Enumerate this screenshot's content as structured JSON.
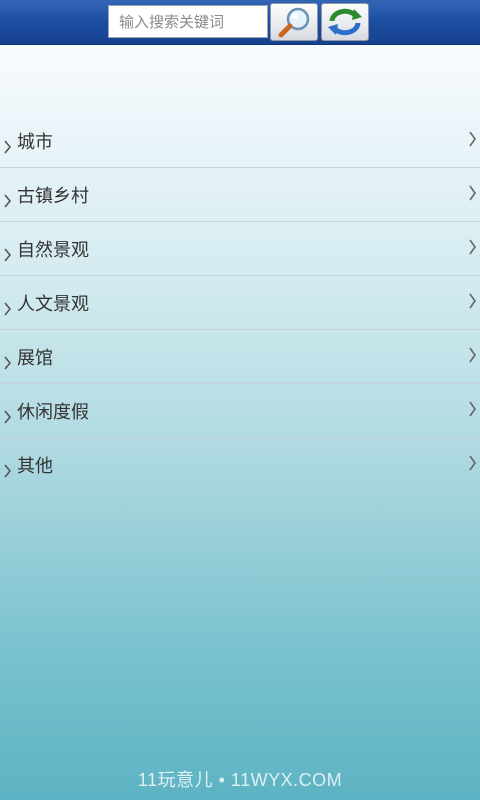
{
  "search": {
    "placeholder": "输入搜索关键词"
  },
  "toolbar": {
    "search_icon": "magnifier-icon",
    "refresh_icon": "refresh-icon"
  },
  "categories": [
    {
      "label": "城市"
    },
    {
      "label": "古镇乡村"
    },
    {
      "label": "自然景观"
    },
    {
      "label": "人文景观"
    },
    {
      "label": "展馆"
    },
    {
      "label": "休闲度假"
    },
    {
      "label": "其他"
    }
  ],
  "watermark": "11玩意儿 • 11WYX.COM",
  "colors": {
    "header": "#1e4fa3",
    "text": "#333333",
    "divider": "#c8d2d6"
  }
}
